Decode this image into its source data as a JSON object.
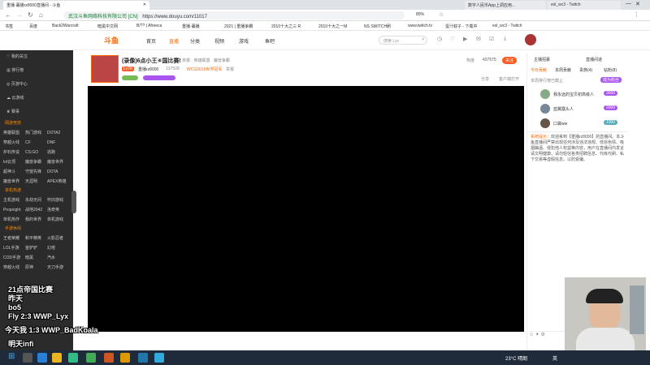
{
  "browser": {
    "tabs": [
      {
        "title": "重播·暮播rz8000直播间 - 斗鱼"
      },
      {
        "title": "数字人民币App上调应用..."
      },
      {
        "title": "esl_wc3 - Twitch"
      }
    ],
    "url": "https://www.douyu.com/11017",
    "security_text": "武汉斗鱼网络科技有限公司 [CN]",
    "zoom": "80%",
    "bookmarks": [
      "书签",
      "百度",
      "Back2Warcraft",
      "暗黑中文网",
      "B/?? | Afreeca",
      "重播·暮播",
      "2021 | 重播争霸",
      "2010十大之三 R",
      "2010十大之一M",
      "NS SWITCH刷",
      "www.twitch.tv",
      "蛋汁蚊子 - 下载中",
      "esl_wc3 - Twitch"
    ]
  },
  "site": {
    "logo": "斗鱼",
    "nav": [
      "首页",
      "直播",
      "分类",
      "视频",
      "游戏",
      "鱼吧"
    ],
    "search_placeholder": "搜索 Lyx"
  },
  "sidebar": {
    "top_items": [
      "我的关注",
      "排行榜",
      "页游中心",
      "云游戏",
      "赛事"
    ],
    "sections": [
      {
        "title": "网游竞技",
        "items": [
          "英雄联盟",
          "热门游戏",
          "DOTA2",
          "穿越火线",
          "CF",
          "DNF",
          "炉石传说",
          "CS:GO",
          "逃跑",
          "lol云顶",
          "魔兽争霸",
          "魔兽世界",
          "超神斗",
          "守望先锋",
          "DOTA",
          "魔兽世界",
          "天涯明",
          "APEX英雄"
        ]
      },
      {
        "title": "单机热游",
        "items": [
          "主机游戏",
          "永劫无间",
          "怀旧游戏",
          "Propnight",
          "战地2042",
          "洛奇英",
          "单机热作",
          "我的世界",
          "单机游戏"
        ]
      },
      {
        "title": "手游休闲",
        "items": [
          "王者荣耀",
          "和平精英",
          "火影忍者",
          "LOL手游",
          "金铲铲",
          "幻塔",
          "COD手游",
          "暗黑",
          "汽水",
          "穿越火线",
          "原神",
          "天刀手游"
        ]
      }
    ]
  },
  "room": {
    "title": "(录像)6点小王④国比赛!",
    "category": "单报 · 英雄联盟 · 魔兽争霸",
    "streamer": "重播rz8000",
    "level": "Lv76",
    "fans": "137528",
    "badge": "WCG2019世界冠军",
    "report": "举报",
    "heat_label": "热度",
    "heat": "437575",
    "follow": "关注",
    "share": "分享",
    "client": "客户端打开"
  },
  "rightpanel": {
    "tabs": [
      "主播招募",
      "直播间道"
    ],
    "subtabs": [
      "今日贡献",
      "本周贡献",
      "贵族(4)",
      "钻粉(8)"
    ],
    "rank_notice": "本周排行榜已截止",
    "rank_button": "成为粉丝",
    "ranks": [
      {
        "name": "我永远的宝贝初高级人",
        "value": "3000"
      },
      {
        "name": "蓝翼露头人",
        "value": "2000"
      },
      {
        "name": "口袋ww",
        "value": "1000"
      }
    ],
    "notice_title": "系统提示：",
    "notice": "欢迎来到【重播rz8000】的直播间。本斗鱼直播间严禁出现任何涉及违法违规、低俗色情、吸烟酗酒、侵犯他人权益等内容，用户在直播间内发言请文明健康。请勿轻信各类招聘信息、代练代刷、私下交易等虚假信息，以防受骗。"
  },
  "overlay": {
    "lines": [
      "21点帝国比赛",
      "昨天",
      "bo5",
      "Fly 2:3 WWP_Lyx",
      "今天我 1:3 WWP_BadKoala",
      "明天infi"
    ]
  },
  "taskbar": {
    "weather": "23°C 晴朗",
    "ime": "英"
  },
  "colors": {
    "accent": "#ff5d23",
    "sidebar_bg": "#2b2b2b",
    "video_bg": "#000000"
  }
}
